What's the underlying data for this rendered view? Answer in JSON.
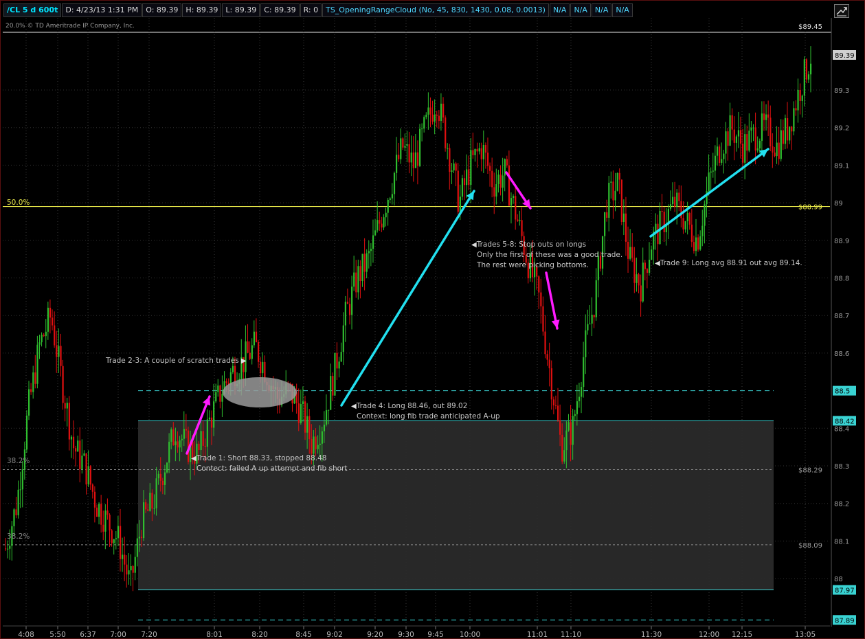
{
  "header": {
    "symbol": "/CL 5 d 600t",
    "date": "D: 4/23/13 1:31 PM",
    "open": "O: 89.39",
    "high": "H: 89.39",
    "low": "L: 89.39",
    "close": "C: 89.39",
    "range": "R: 0",
    "study": "TS_OpeningRangeCloud (No, 45, 830, 1430, 0.08, 0.0013)",
    "na_fields": [
      "N/A",
      "N/A",
      "N/A",
      "N/A"
    ]
  },
  "copyright": "© TD Ameritrade IP Company, Inc.",
  "copyright_prefix": "20.0%",
  "colors": {
    "background": "#000000",
    "up_candle": "#2fbf2f",
    "down_candle": "#e01010",
    "fib_line": "#e8e84a",
    "range_line": "#39d2d2",
    "range_fill": "#2a2a2a",
    "cyan_arrow": "#22e0f0",
    "magenta_arrow": "#ff1aff"
  },
  "price_axis": {
    "ticks": [
      "89.3",
      "89.2",
      "89.1",
      "89",
      "88.9",
      "88.8",
      "88.7",
      "88.6",
      "88.4",
      "88.3",
      "88.2",
      "88.1",
      "88"
    ],
    "labels": {
      "top": "$89.45",
      "last": "89.39",
      "fib50": "$88.99",
      "range_top_mid": "88.5",
      "range_top": "88.42",
      "range_mid1": "$88.29",
      "range_mid2": "$88.09",
      "range_bottom": "87.97",
      "range_low": "87.89"
    }
  },
  "fib_labels": {
    "fib50": "50.0%",
    "fib382a": "38.2%",
    "fib382b": "38.2%"
  },
  "time_axis": [
    "4:08",
    "5:50",
    "6:37",
    "7:00",
    "7:20",
    "8:01",
    "8:20",
    "8:45",
    "9:02",
    "9:20",
    "9:30",
    "9:45",
    "10:00",
    "11:01",
    "11:10",
    "11:30",
    "12:00",
    "12:15",
    "13:05"
  ],
  "annotations": {
    "trade1_line1": "Trade 1: Short 88.33, stopped 88.48",
    "trade1_line2": "Contect: failed A up attempt and fib short",
    "trade23": "Trade 2-3: A couple of scratch trades",
    "trade4_line1": "Trade 4: Long 88.46, out 89.02",
    "trade4_line2": "Context: long fib trade anticipated A-up",
    "trade58_line1": "Trades 5-8: Stop outs on longs",
    "trade58_line2": "Only the first of these was a good trade.",
    "trade58_line3": "The rest were picking bottoms.",
    "trade9": "Trade 9: Long avg 88.91 out avg 89.14."
  },
  "chart_data": {
    "type": "candlestick",
    "y_range": [
      87.87,
      89.46
    ],
    "x_ticks": [
      "4:08",
      "5:50",
      "6:37",
      "7:00",
      "7:20",
      "8:01",
      "8:20",
      "8:45",
      "9:02",
      "9:20",
      "9:30",
      "9:45",
      "10:00",
      "11:01",
      "11:10",
      "11:30",
      "12:00",
      "12:15",
      "13:05"
    ],
    "close_path": [
      88.08,
      88.2,
      88.45,
      88.62,
      88.7,
      88.52,
      88.35,
      88.3,
      88.2,
      88.15,
      88.1,
      87.98,
      88.15,
      88.2,
      88.3,
      88.4,
      88.35,
      88.33,
      88.42,
      88.5,
      88.55,
      88.58,
      88.62,
      88.55,
      88.48,
      88.5,
      88.45,
      88.36,
      88.42,
      88.55,
      88.7,
      88.8,
      88.85,
      88.95,
      89.05,
      89.15,
      89.1,
      89.2,
      89.28,
      89.15,
      89.0,
      89.1,
      89.15,
      89.05,
      89.08,
      88.97,
      88.85,
      88.75,
      88.55,
      88.35,
      88.4,
      88.6,
      88.75,
      89.0,
      89.05,
      88.85,
      88.78,
      88.9,
      88.95,
      89.0,
      88.95,
      88.9,
      89.05,
      89.15,
      89.2,
      89.15,
      89.18,
      89.2,
      89.15,
      89.2,
      89.3,
      89.39
    ]
  }
}
